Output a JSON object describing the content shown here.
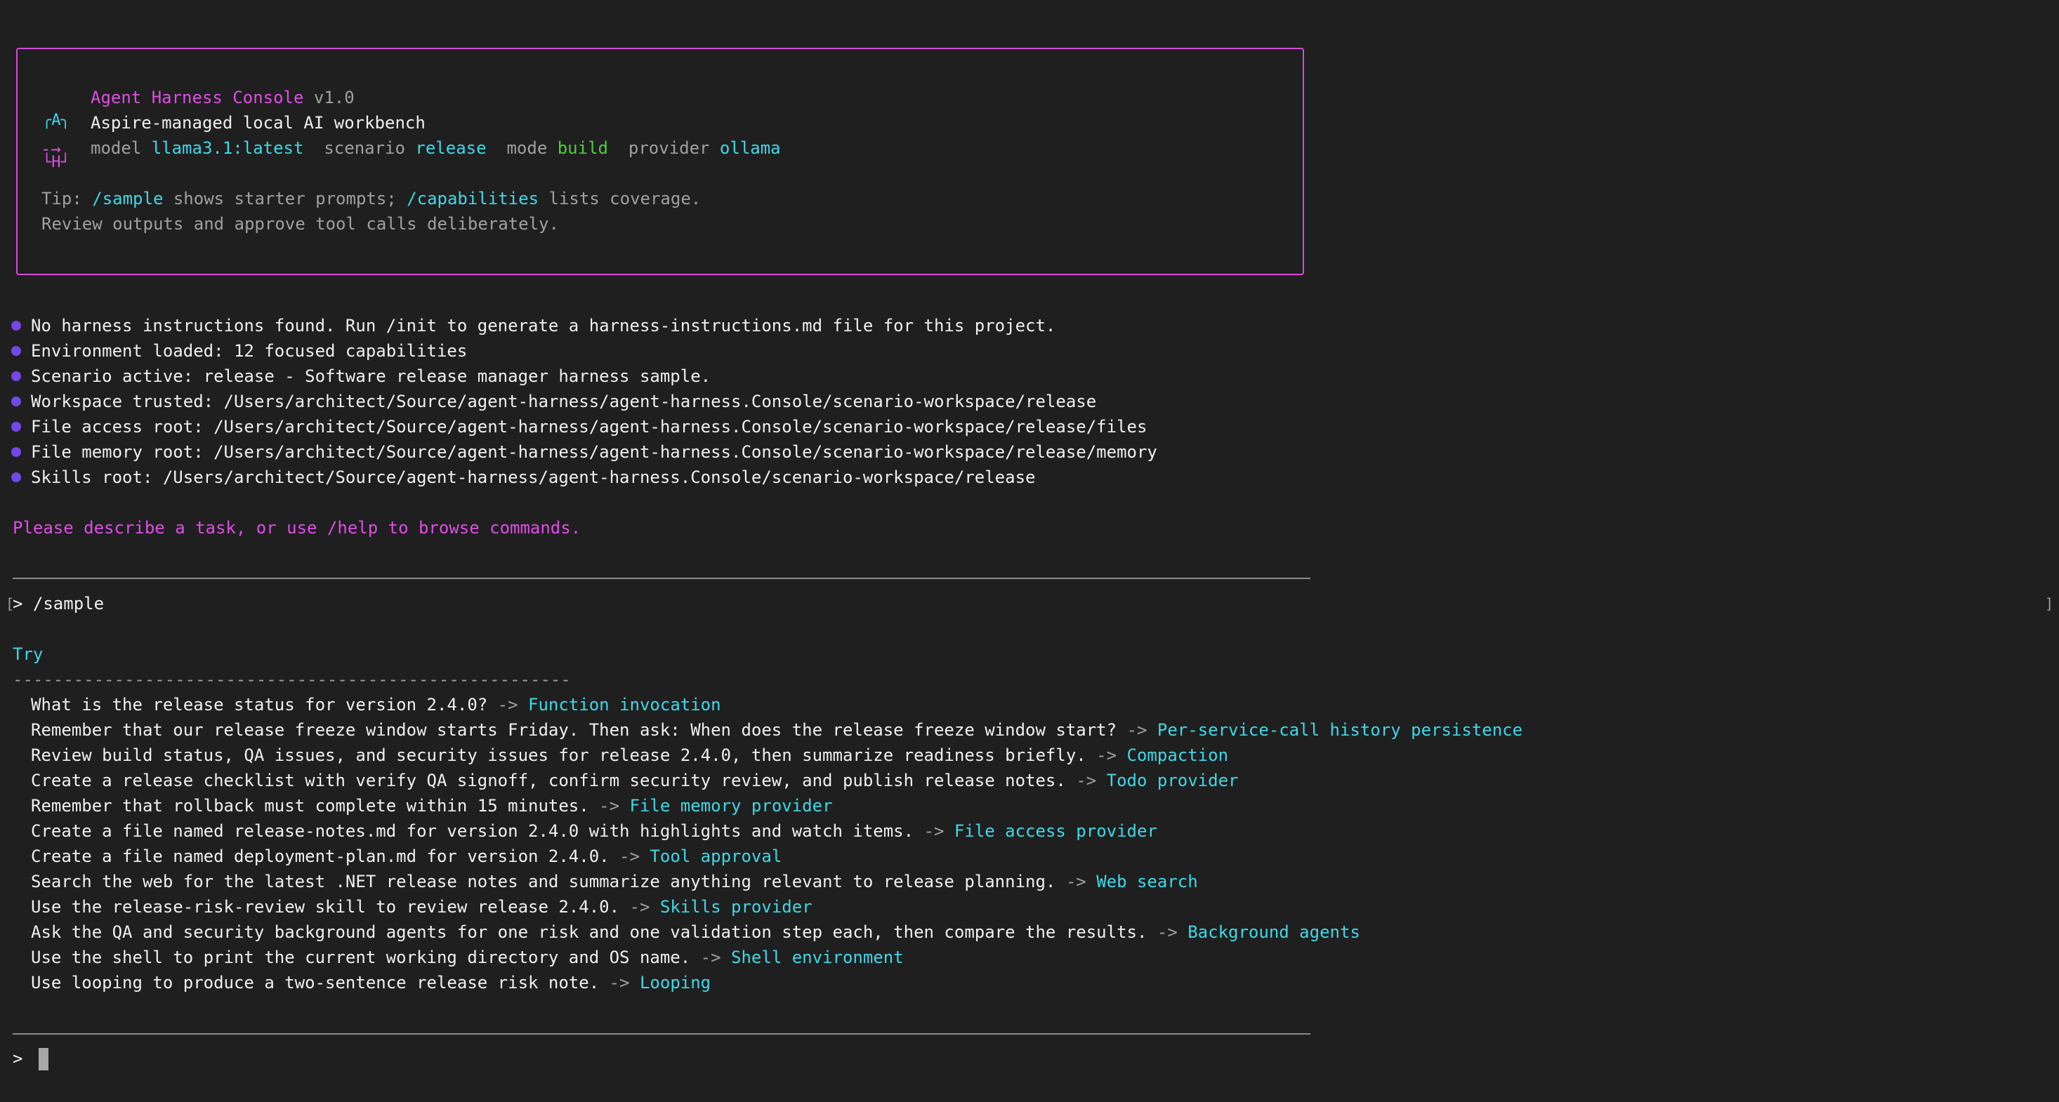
{
  "banner": {
    "logo_glyph_top": "╭A╮",
    "logo_glyph_bottom": "└H┘",
    "arrow_glyph": "-→",
    "app_name": "Agent Harness Console",
    "version": "v1.0",
    "subtitle": "Aspire-managed local AI workbench",
    "status": {
      "model_label": "model",
      "model_value": "llama3.1:latest",
      "scenario_label": "scenario",
      "scenario_value": "release",
      "mode_label": "mode",
      "mode_value": "build",
      "provider_label": "provider",
      "provider_value": "ollama"
    },
    "tip_prefix": "Tip: ",
    "tip_cmd1": "/sample",
    "tip_mid": " shows starter prompts; ",
    "tip_cmd2": "/capabilities",
    "tip_suffix": " lists coverage.",
    "tip_line2": "Review outputs and approve tool calls deliberately."
  },
  "messages": [
    "No harness instructions found. Run /init to generate a harness-instructions.md file for this project.",
    "Environment loaded: 12 focused capabilities",
    "Scenario active: release - Software release manager harness sample.",
    "Workspace trusted: /Users/architect/Source/agent-harness/agent-harness.Console/scenario-workspace/release",
    "File access root: /Users/architect/Source/agent-harness/agent-harness.Console/scenario-workspace/release/files",
    "File memory root: /Users/architect/Source/agent-harness/agent-harness.Console/scenario-workspace/release/memory",
    "Skills root: /Users/architect/Source/agent-harness/agent-harness.Console/scenario-workspace/release"
  ],
  "prompt_hint": "Please describe a task, or use /help to browse commands.",
  "history": {
    "prompt_symbol": ">",
    "command": "/sample",
    "left_bracket": "[",
    "right_bracket": "]"
  },
  "try": {
    "heading": "Try",
    "underline": "-------------------------------------------------------",
    "arrow": "->",
    "items": [
      {
        "prompt": "What is the release status for version 2.4.0?",
        "capability": "Function invocation"
      },
      {
        "prompt": "Remember that our release freeze window starts Friday. Then ask: When does the release freeze window start?",
        "capability": "Per-service-call history persistence"
      },
      {
        "prompt": "Review build status, QA issues, and security issues for release 2.4.0, then summarize readiness briefly.",
        "capability": "Compaction"
      },
      {
        "prompt": "Create a release checklist with verify QA signoff, confirm security review, and publish release notes.",
        "capability": "Todo provider"
      },
      {
        "prompt": "Remember that rollback must complete within 15 minutes.",
        "capability": "File memory provider"
      },
      {
        "prompt": "Create a file named release-notes.md for version 2.4.0 with highlights and watch items.",
        "capability": "File access provider"
      },
      {
        "prompt": "Create a file named deployment-plan.md for version 2.4.0.",
        "capability": "Tool approval"
      },
      {
        "prompt": "Search the web for the latest .NET release notes and summarize anything relevant to release planning.",
        "capability": "Web search"
      },
      {
        "prompt": "Use the release-risk-review skill to review release 2.4.0.",
        "capability": "Skills provider"
      },
      {
        "prompt": "Ask the QA and security background agents for one risk and one validation step each, then compare the results.",
        "capability": "Background agents"
      },
      {
        "prompt": "Use the shell to print the current working directory and OS name.",
        "capability": "Shell environment"
      },
      {
        "prompt": "Use looping to produce a two-sentence release risk note.",
        "capability": "Looping"
      }
    ]
  },
  "input": {
    "prompt_symbol": ">",
    "value": ""
  }
}
